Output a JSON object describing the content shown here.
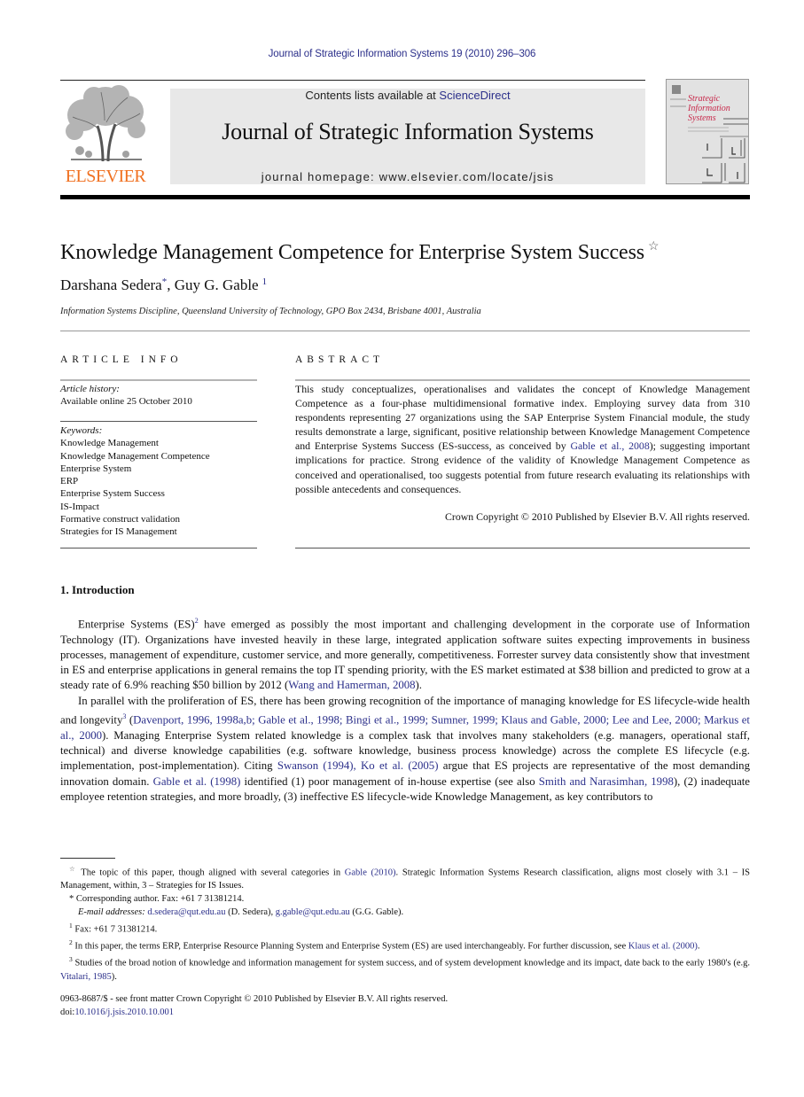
{
  "header": {
    "running_head": "Journal of Strategic Information Systems 19 (2010) 296–306",
    "publisher_logo_text": "ELSEVIER",
    "contents_prefix": "Contents lists available at ",
    "contents_link": "ScienceDirect",
    "journal_name": "Journal of Strategic Information Systems",
    "homepage": "journal homepage: www.elsevier.com/locate/jsis",
    "cover_title_lines": [
      "Strategic",
      "Information",
      "Systems"
    ]
  },
  "article": {
    "title": "Knowledge Management Competence for Enterprise System Success",
    "title_note_mark": "☆",
    "authors": [
      {
        "name": "Darshana Sedera",
        "mark": "*"
      },
      {
        "name": "Guy G. Gable",
        "mark": "1"
      }
    ],
    "author_separator": ", ",
    "affiliation": "Information Systems Discipline, Queensland University of Technology, GPO Box 2434, Brisbane 4001, Australia"
  },
  "article_info": {
    "heading": "ARTICLE INFO",
    "history_label": "Article history:",
    "history_value": "Available online 25 October 2010",
    "keywords_label": "Keywords:",
    "keywords": [
      "Knowledge Management",
      "Knowledge Management Competence",
      "Enterprise System",
      "ERP",
      "Enterprise System Success",
      "IS-Impact",
      "Formative construct validation",
      "Strategies for IS Management"
    ]
  },
  "abstract": {
    "heading": "ABSTRACT",
    "text_before_link": "This study conceptualizes, operationalises and validates the concept of Knowledge Management Competence as a four-phase multidimensional formative index. Employing survey data from 310 respondents representing 27 organizations using the SAP Enterprise System Financial module, the study results demonstrate a large, significant, positive relationship between Knowledge Management Competence and Enterprise Systems Success (ES-success, as conceived by ",
    "link": "Gable et al., 2008",
    "text_after_link": "); suggesting important implications for practice. Strong evidence of the validity of Knowledge Management Competence as conceived and operationalised, too suggests potential from future research evaluating its relationships with possible antecedents and consequences.",
    "copyright": "Crown Copyright © 2010 Published by Elsevier B.V. All rights reserved."
  },
  "introduction": {
    "heading": "1. Introduction",
    "p1": {
      "a": "Enterprise Systems (ES)",
      "sup": "2",
      "b": " have emerged as possibly the most important and challenging development in the corporate use of Information Technology (IT). Organizations have invested heavily in these large, integrated application software suites expecting improvements in business processes, management of expenditure, customer service, and more generally, competitiveness. Forrester survey data consistently show that investment in ES and enterprise applications in general remains the top IT spending priority, with the ES market estimated at $38 billion and predicted to grow at a steady rate of 6.9% reaching $50 billion by 2012 (",
      "link": "Wang and Hamerman, 2008",
      "c": ")."
    },
    "p2": {
      "a": "In parallel with the proliferation of ES, there has been growing recognition of the importance of managing knowledge for ES lifecycle-wide health and longevity",
      "sup": "3",
      "b": " (",
      "link1": "Davenport, 1996, 1998a,b; Gable et al., 1998; Bingi et al., 1999; Sumner, 1999; Klaus and Gable, 2000; Lee and Lee, 2000; Markus et al., 2000",
      "c": "). Managing Enterprise System related knowledge is a complex task that involves many stakeholders (e.g. managers, operational staff, technical) and diverse knowledge capabilities (e.g. software knowledge, business process knowledge) across the complete ES lifecycle (e.g. implementation, post-implementation). Citing ",
      "link2": "Swanson (1994), Ko et al. (2005)",
      "d": " argue that ES projects are representative of the most demanding innovation domain. ",
      "link3": "Gable et al. (1998)",
      "e": " identified (1) poor management of in-house expertise (see also ",
      "link4": "Smith and Narasimhan, 1998",
      "f": "), (2) inadequate employee retention strategies, and more broadly, (3) ineffective ES lifecycle-wide Knowledge Management, as key contributors to"
    }
  },
  "footnotes": {
    "star": {
      "mark": "☆",
      "a": " The topic of this paper, though aligned with several categories in ",
      "link": "Gable (2010)",
      "b": ". Strategic Information Systems Research classification, aligns most closely with 3.1 – IS Management, within, 3 – Strategies for IS Issues."
    },
    "corresponding": {
      "mark": "*",
      "text": " Corresponding author. Fax: +61 7 31381214."
    },
    "email": {
      "label": "E-mail addresses: ",
      "email1": "d.sedera@qut.edu.au",
      "who1": " (D. Sedera), ",
      "email2": "g.gable@qut.edu.au",
      "who2": " (G.G. Gable)."
    },
    "fn1": {
      "mark": "1",
      "text": " Fax: +61 7 31381214."
    },
    "fn2": {
      "mark": "2",
      "a": " In this paper, the terms ERP, Enterprise Resource Planning System and Enterprise System (ES) are used interchangeably. For further discussion, see ",
      "link": "Klaus et al. (2000)",
      "b": "."
    },
    "fn3": {
      "mark": "3",
      "a": " Studies of the broad notion of knowledge and information management for system success, and of system development knowledge and its impact, date back to the early 1980's (e.g. ",
      "link": "Vitalari, 1985",
      "b": ")."
    }
  },
  "bottom": {
    "issn_line": "0963-8687/$ - see front matter Crown Copyright © 2010 Published by Elsevier B.V. All rights reserved.",
    "doi_prefix": "doi:",
    "doi": "10.1016/j.jsis.2010.10.001"
  },
  "colors": {
    "link": "#2b2f8a",
    "elsevier_orange": "#f07020",
    "masthead_gray": "#e8e8e8",
    "cover_title": "#c8284a"
  }
}
